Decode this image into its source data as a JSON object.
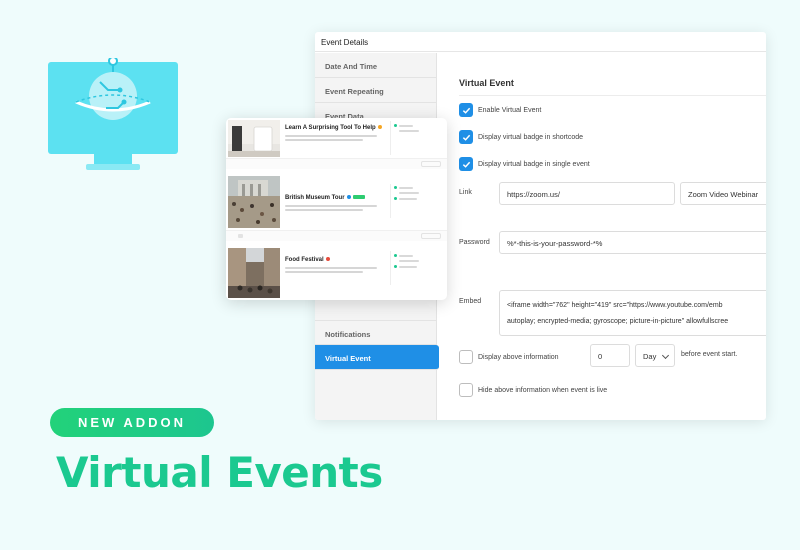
{
  "colors": {
    "accent_green": "#1bc990",
    "accent_blue": "#1f8fe6",
    "icon_cyan": "#5ce1f1",
    "background": "#effcfc"
  },
  "badge": {
    "label": "NEW ADDON"
  },
  "hero": {
    "title": "Virtual Events"
  },
  "panel": {
    "header": "Event Details",
    "sidebar": [
      {
        "label": "Date And Time",
        "active": false
      },
      {
        "label": "Event Repeating",
        "active": false
      },
      {
        "label": "Event Data",
        "active": false
      },
      {
        "label": "Notifications",
        "active": false
      },
      {
        "label": "Virtual Event",
        "active": true
      }
    ],
    "section_title": "Virtual Event",
    "checkboxes": [
      {
        "label": "Enable Virtual Event",
        "checked": true
      },
      {
        "label": "Display virtual badge in shortcode",
        "checked": true
      },
      {
        "label": "Display virtual badge in single event",
        "checked": true
      }
    ],
    "link": {
      "label": "Link",
      "value": "https://zoom.us/",
      "type_value": "Zoom Video Webinar"
    },
    "password": {
      "label": "Password",
      "value": "%*-this-is-your-password-*%"
    },
    "embed": {
      "label": "Embed",
      "line1": "<iframe width=\"762\" height=\"419\" src=\"https://www.youtube.com/emb",
      "line2": "autoplay; encrypted-media; gyroscope; picture-in-picture\" allowfullscree"
    },
    "display_above": {
      "label": "Display above information",
      "number": "0",
      "unit": "Day",
      "suffix": "before event start."
    },
    "hide_above": {
      "label": "Hide above information when event is live"
    }
  },
  "events": [
    {
      "title": "Learn A Surprising Tool To Help",
      "tag_color": "#f5a623",
      "image": "white-chair-room"
    },
    {
      "title": "British Museum Tour",
      "tag_color": "#1f8fe6",
      "tag2_color": "#2ecc71",
      "image": "museum-crowd"
    },
    {
      "title": "Food Festival",
      "tag_color": "#e74c3c",
      "image": "city-street"
    }
  ]
}
